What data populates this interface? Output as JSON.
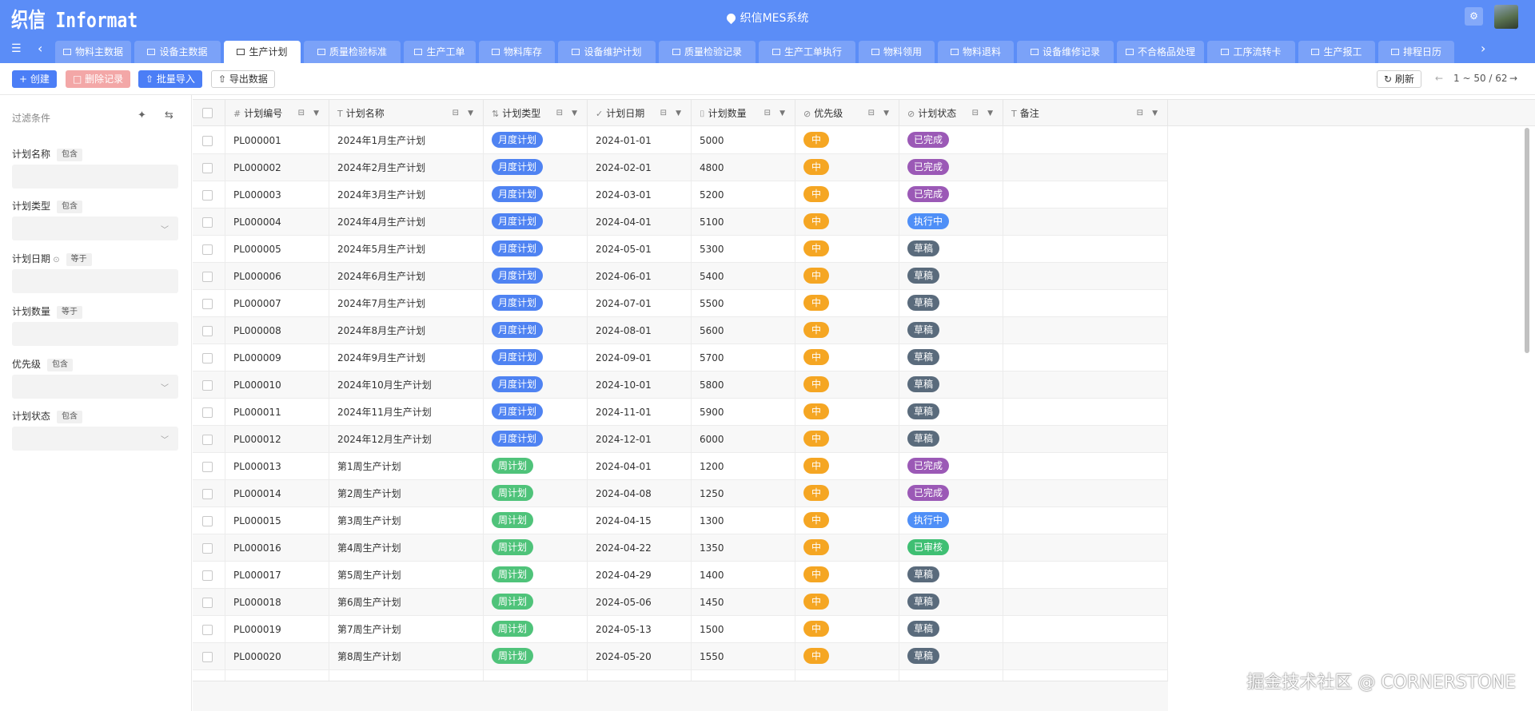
{
  "app": {
    "logo": "织信 Informat",
    "title": "织信MES系统"
  },
  "tabs": [
    {
      "label": "物料主数据",
      "active": false
    },
    {
      "label": "设备主数据",
      "active": false
    },
    {
      "label": "生产计划",
      "active": true
    },
    {
      "label": "质量检验标准",
      "active": false
    },
    {
      "label": "生产工单",
      "active": false
    },
    {
      "label": "物料库存",
      "active": false
    },
    {
      "label": "设备维护计划",
      "active": false
    },
    {
      "label": "质量检验记录",
      "active": false
    },
    {
      "label": "生产工单执行",
      "active": false
    },
    {
      "label": "物料领用",
      "active": false
    },
    {
      "label": "物料退料",
      "active": false
    },
    {
      "label": "设备维修记录",
      "active": false
    },
    {
      "label": "不合格品处理",
      "active": false
    },
    {
      "label": "工序流转卡",
      "active": false
    },
    {
      "label": "生产报工",
      "active": false
    },
    {
      "label": "排程日历",
      "active": false
    }
  ],
  "toolbar": {
    "create": "+ 创建",
    "delete": "删除记录",
    "import": "批量导入",
    "export": "导出数据",
    "refresh": "刷新",
    "pagination": "1 ~ 50 / 62"
  },
  "filter": {
    "heading": "过滤条件",
    "fields": [
      {
        "label": "计划名称",
        "op": "包含",
        "type": "text"
      },
      {
        "label": "计划类型",
        "op": "包含",
        "type": "select"
      },
      {
        "label": "计划日期",
        "op": "等于",
        "type": "date"
      },
      {
        "label": "计划数量",
        "op": "等于",
        "type": "text"
      },
      {
        "label": "优先级",
        "op": "包含",
        "type": "select"
      },
      {
        "label": "计划状态",
        "op": "包含",
        "type": "select"
      }
    ]
  },
  "columns": [
    "计划编号",
    "计划名称",
    "计划类型",
    "计划日期",
    "计划数量",
    "优先级",
    "计划状态",
    "备注"
  ],
  "colors": {
    "brand": "#5b8df7",
    "monthly": "#4f83f2",
    "weekly": "#4fc37a",
    "priority": "#f5a623",
    "done": "#9b59b6",
    "running": "#4f8ff7",
    "draft": "#5a6b7c",
    "approved": "#3fbf73"
  },
  "rows": [
    {
      "id": "PL000001",
      "name": "2024年1月生产计划",
      "type": "月度计划",
      "date": "2024-01-01",
      "qty": "5000",
      "priority": "中",
      "status": "已完成",
      "note": ""
    },
    {
      "id": "PL000002",
      "name": "2024年2月生产计划",
      "type": "月度计划",
      "date": "2024-02-01",
      "qty": "4800",
      "priority": "中",
      "status": "已完成",
      "note": ""
    },
    {
      "id": "PL000003",
      "name": "2024年3月生产计划",
      "type": "月度计划",
      "date": "2024-03-01",
      "qty": "5200",
      "priority": "中",
      "status": "已完成",
      "note": ""
    },
    {
      "id": "PL000004",
      "name": "2024年4月生产计划",
      "type": "月度计划",
      "date": "2024-04-01",
      "qty": "5100",
      "priority": "中",
      "status": "执行中",
      "note": ""
    },
    {
      "id": "PL000005",
      "name": "2024年5月生产计划",
      "type": "月度计划",
      "date": "2024-05-01",
      "qty": "5300",
      "priority": "中",
      "status": "草稿",
      "note": ""
    },
    {
      "id": "PL000006",
      "name": "2024年6月生产计划",
      "type": "月度计划",
      "date": "2024-06-01",
      "qty": "5400",
      "priority": "中",
      "status": "草稿",
      "note": ""
    },
    {
      "id": "PL000007",
      "name": "2024年7月生产计划",
      "type": "月度计划",
      "date": "2024-07-01",
      "qty": "5500",
      "priority": "中",
      "status": "草稿",
      "note": ""
    },
    {
      "id": "PL000008",
      "name": "2024年8月生产计划",
      "type": "月度计划",
      "date": "2024-08-01",
      "qty": "5600",
      "priority": "中",
      "status": "草稿",
      "note": ""
    },
    {
      "id": "PL000009",
      "name": "2024年9月生产计划",
      "type": "月度计划",
      "date": "2024-09-01",
      "qty": "5700",
      "priority": "中",
      "status": "草稿",
      "note": ""
    },
    {
      "id": "PL000010",
      "name": "2024年10月生产计划",
      "type": "月度计划",
      "date": "2024-10-01",
      "qty": "5800",
      "priority": "中",
      "status": "草稿",
      "note": ""
    },
    {
      "id": "PL000011",
      "name": "2024年11月生产计划",
      "type": "月度计划",
      "date": "2024-11-01",
      "qty": "5900",
      "priority": "中",
      "status": "草稿",
      "note": ""
    },
    {
      "id": "PL000012",
      "name": "2024年12月生产计划",
      "type": "月度计划",
      "date": "2024-12-01",
      "qty": "6000",
      "priority": "中",
      "status": "草稿",
      "note": ""
    },
    {
      "id": "PL000013",
      "name": "第1周生产计划",
      "type": "周计划",
      "date": "2024-04-01",
      "qty": "1200",
      "priority": "中",
      "status": "已完成",
      "note": ""
    },
    {
      "id": "PL000014",
      "name": "第2周生产计划",
      "type": "周计划",
      "date": "2024-04-08",
      "qty": "1250",
      "priority": "中",
      "status": "已完成",
      "note": ""
    },
    {
      "id": "PL000015",
      "name": "第3周生产计划",
      "type": "周计划",
      "date": "2024-04-15",
      "qty": "1300",
      "priority": "中",
      "status": "执行中",
      "note": ""
    },
    {
      "id": "PL000016",
      "name": "第4周生产计划",
      "type": "周计划",
      "date": "2024-04-22",
      "qty": "1350",
      "priority": "中",
      "status": "已审核",
      "note": ""
    },
    {
      "id": "PL000017",
      "name": "第5周生产计划",
      "type": "周计划",
      "date": "2024-04-29",
      "qty": "1400",
      "priority": "中",
      "status": "草稿",
      "note": ""
    },
    {
      "id": "PL000018",
      "name": "第6周生产计划",
      "type": "周计划",
      "date": "2024-05-06",
      "qty": "1450",
      "priority": "中",
      "status": "草稿",
      "note": ""
    },
    {
      "id": "PL000019",
      "name": "第7周生产计划",
      "type": "周计划",
      "date": "2024-05-13",
      "qty": "1500",
      "priority": "中",
      "status": "草稿",
      "note": ""
    },
    {
      "id": "PL000020",
      "name": "第8周生产计划",
      "type": "周计划",
      "date": "2024-05-20",
      "qty": "1550",
      "priority": "中",
      "status": "草稿",
      "note": ""
    }
  ],
  "watermark": "掘金技术社区 @ CORNERSTONE"
}
